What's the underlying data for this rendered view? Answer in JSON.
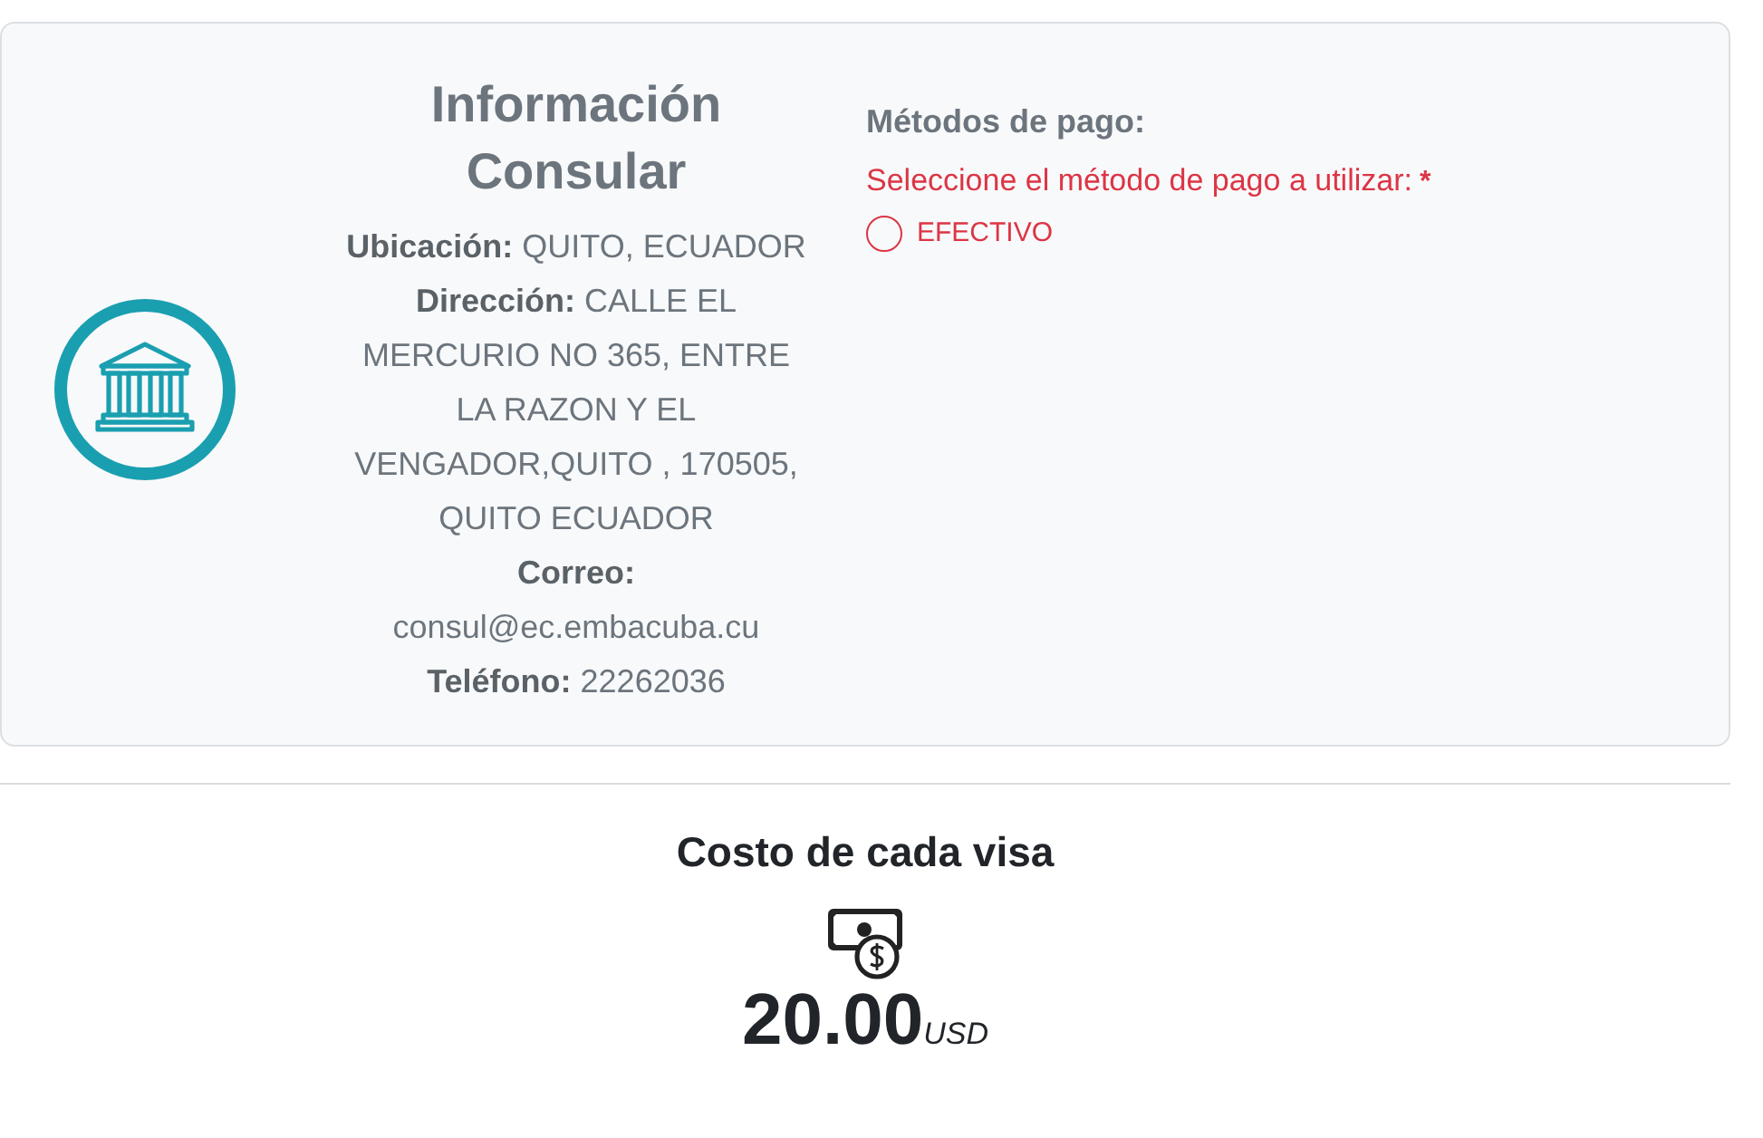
{
  "consular_info": {
    "title": "Información Consular",
    "fields": [
      "**Ubicación:** QUITO, ECUADOR",
      "**Dirección:** CALLE EL MERCURIO NO 365, ENTRE LA RAZON Y EL VENGADOR,QUITO , 170505, QUITO ECUADOR",
      "**Correo:** consul@ec.embacuba.cu",
      "**Teléfono:** 22262036"
    ]
  },
  "payment": {
    "title": "Métodos de pago:",
    "prompt": "Seleccione el método de pago a utilizar:",
    "required_mark": "*",
    "options": [
      {
        "label": "EFECTIVO",
        "selected": false
      }
    ]
  },
  "cost": {
    "title": "Costo de cada visa",
    "amount": "20.00",
    "currency": "USD"
  }
}
